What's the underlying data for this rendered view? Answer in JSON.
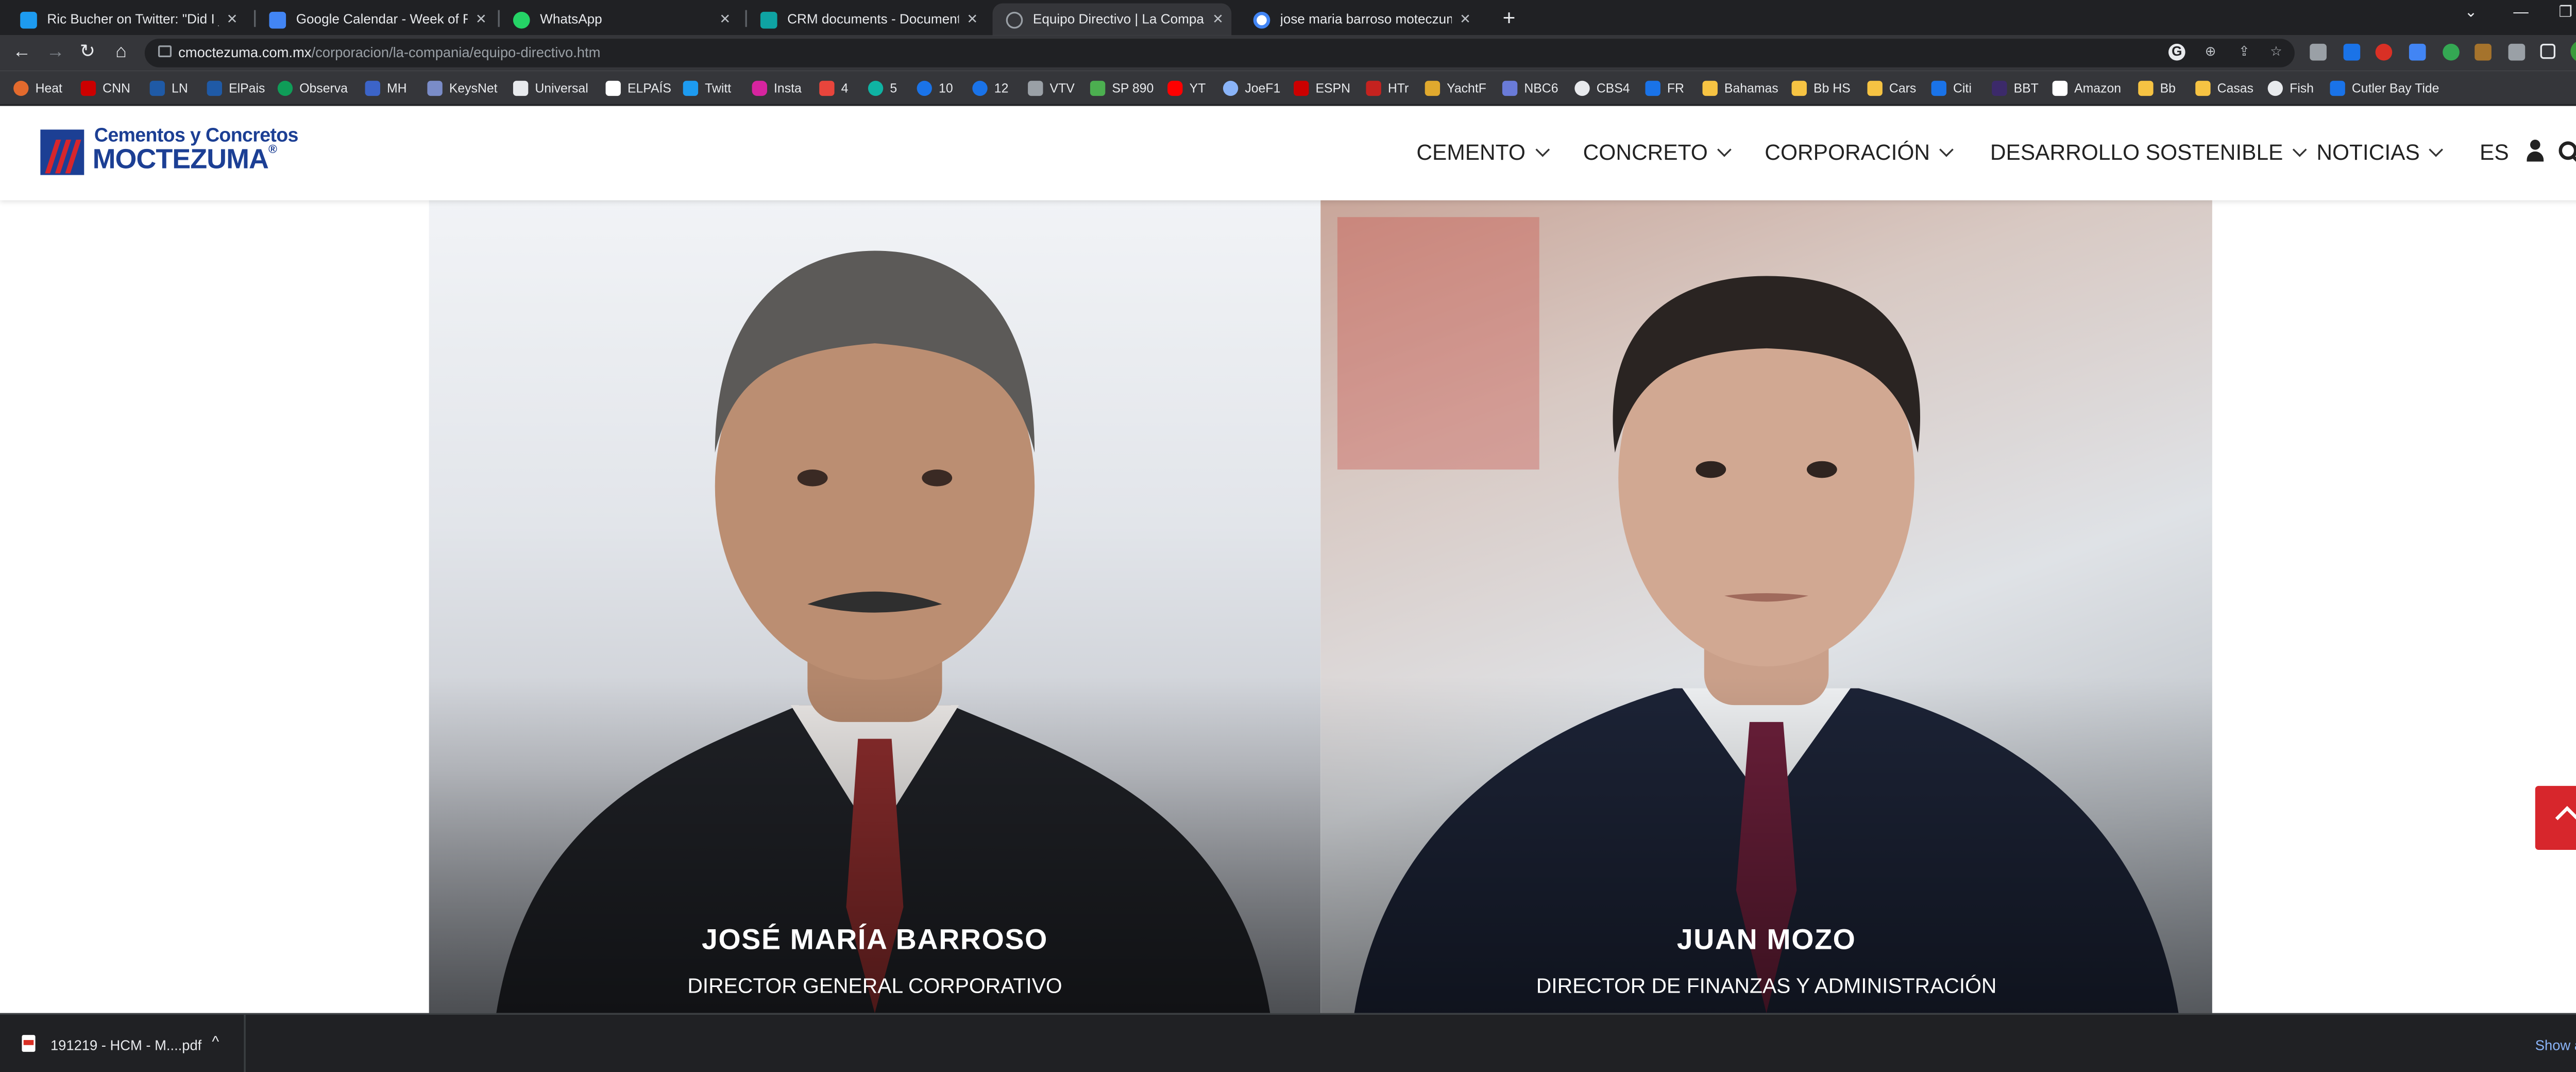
{
  "browser": {
    "tabs": [
      {
        "title": "Ric Bucher on Twitter: \"Did I just",
        "favicon_color": "#1d9bf0",
        "active": false
      },
      {
        "title": "Google Calendar - Week of Febru",
        "favicon_color": "#4285f4",
        "active": false
      },
      {
        "title": "WhatsApp",
        "favicon_color": "#25d366",
        "active": false
      },
      {
        "title": "CRM documents - Documents - A",
        "favicon_color": "#0fa3a3",
        "active": false
      },
      {
        "title": "Equipo Directivo | La Compañía |",
        "favicon_color": "#9aa0a6",
        "active": true
      },
      {
        "title": "jose maria barroso moteczuma - G",
        "favicon_color": "#ffffff",
        "active": false
      }
    ],
    "new_tab_glyph": "+",
    "url_host": "cmoctezuma.com.mx",
    "url_path": "/corporacion/la-compania/equipo-directivo.htm",
    "bookmarks": [
      "Heat",
      "CNN",
      "LN",
      "ElPais",
      "Observa",
      "MH",
      "KeysNet",
      "Universal",
      "ELPAÍS",
      "Twitt",
      "Insta",
      "4",
      "5",
      "10",
      "12",
      "VTV",
      "SP 890",
      "YT",
      "JoeF1",
      "ESPN",
      "HTr",
      "YachtF",
      "NBC6",
      "CBS4",
      "FR",
      "Bahamas",
      "Bb HS",
      "Cars",
      "Citi",
      "BBT",
      "Amazon",
      "Bb",
      "Casas",
      "Fish",
      "Cutler Bay Tide"
    ],
    "profile_initial": "J",
    "colors": {
      "chrome_dark": "#202124",
      "chrome_mid": "#35363a",
      "link_blue": "#8ab4f8"
    }
  },
  "site": {
    "logo_line1": "Cementos y Concretos",
    "logo_line2": "MOCTEZUMA",
    "logo_registered": "®",
    "brand_blue": "#1c3f94",
    "brand_red": "#d7262c",
    "nav": [
      "CEMENTO",
      "CONCRETO",
      "CORPORACIÓN",
      "DESARROLLO SOSTENIBLE",
      "NOTICIAS"
    ],
    "language": "ES",
    "executives": [
      {
        "name": "JOSÉ MARÍA BARROSO",
        "role": "DIRECTOR GENERAL CORPORATIVO"
      },
      {
        "name": "JUAN MOZO",
        "role": "DIRECTOR DE FINANZAS Y ADMINISTRACIÓN"
      }
    ]
  },
  "downloads": {
    "file_name": "191219 - HCM - M....pdf",
    "show_all": "Show all"
  }
}
